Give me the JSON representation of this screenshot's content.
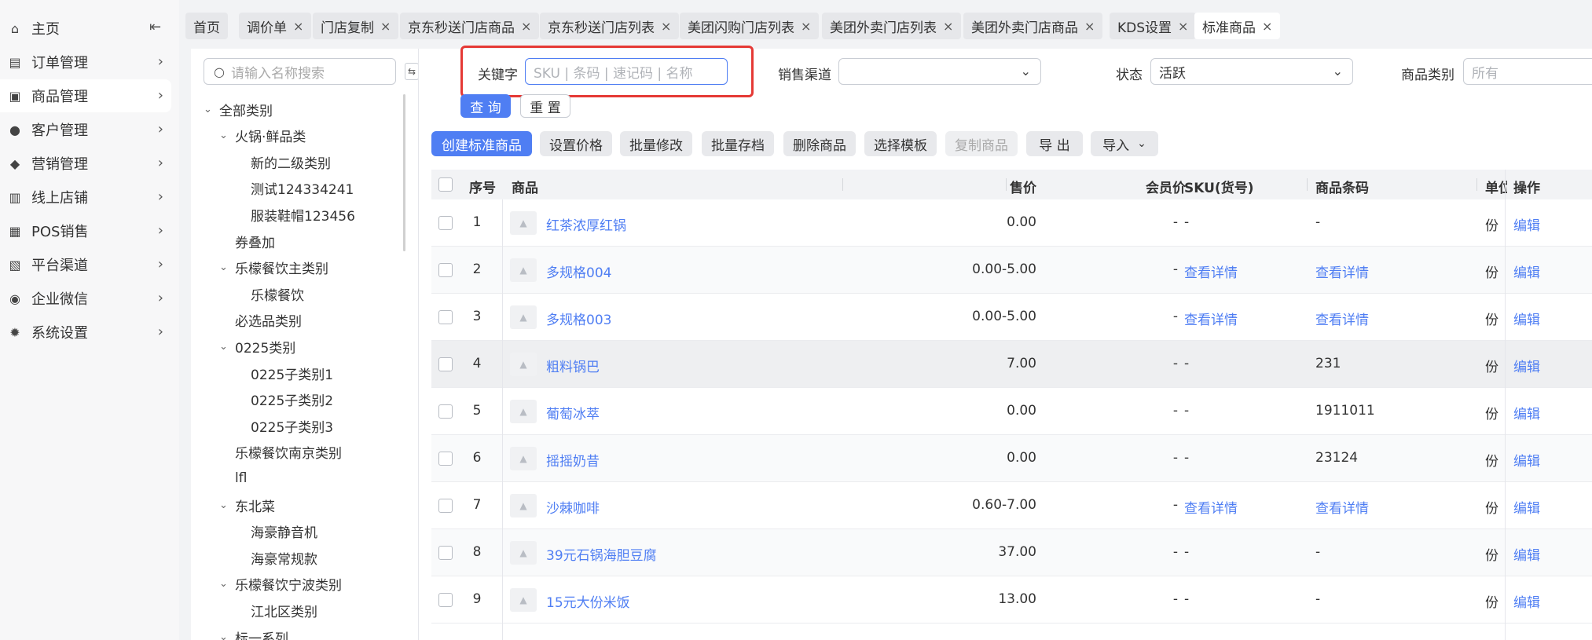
{
  "nav": {
    "items": [
      {
        "label": "主页",
        "icon": "home-icon",
        "glyph": "⌂",
        "has_chevron": false
      },
      {
        "label": "订单管理",
        "icon": "order-icon",
        "glyph": "▤",
        "has_chevron": true
      },
      {
        "label": "商品管理",
        "icon": "goods-icon",
        "glyph": "▣",
        "has_chevron": true
      },
      {
        "label": "客户管理",
        "icon": "customer-icon",
        "glyph": "●",
        "has_chevron": true
      },
      {
        "label": "营销管理",
        "icon": "tag-icon",
        "glyph": "◆",
        "has_chevron": true
      },
      {
        "label": "线上店铺",
        "icon": "store-icon",
        "glyph": "▥",
        "has_chevron": true
      },
      {
        "label": "POS销售",
        "icon": "pos-icon",
        "glyph": "▦",
        "has_chevron": true
      },
      {
        "label": "平台渠道",
        "icon": "bank-icon",
        "glyph": "▧",
        "has_chevron": true
      },
      {
        "label": "企业微信",
        "icon": "wechat-icon",
        "glyph": "◉",
        "has_chevron": true
      },
      {
        "label": "系统设置",
        "icon": "gear-icon",
        "glyph": "✹",
        "has_chevron": true
      }
    ],
    "active_index": 2,
    "collapse_glyph": "⇤",
    "chevron_glyph": "›"
  },
  "tabs": [
    {
      "label": "首页",
      "closable": false
    },
    {
      "label": "调价单",
      "closable": true
    },
    {
      "label": "门店复制",
      "closable": true
    },
    {
      "label": "京东秒送门店商品",
      "closable": true
    },
    {
      "label": "京东秒送门店列表",
      "closable": true
    },
    {
      "label": "美团闪购门店列表",
      "closable": true
    },
    {
      "label": "美团外卖门店列表",
      "closable": true
    },
    {
      "label": "美团外卖门店商品",
      "closable": true
    },
    {
      "label": "KDS设置",
      "closable": true
    },
    {
      "label": "标准商品",
      "closable": true
    }
  ],
  "active_tab": 9,
  "category": {
    "search_placeholder": "请输入名称搜索",
    "toggle_glyph": "⇆",
    "tree": [
      {
        "label": "全部类别",
        "level": 0,
        "expanded": true
      },
      {
        "label": "火锅·鲜品类",
        "level": 1,
        "expanded": true
      },
      {
        "label": "新的二级类别",
        "level": 2
      },
      {
        "label": "测试124334241",
        "level": 2
      },
      {
        "label": "服装鞋帽123456",
        "level": 2
      },
      {
        "label": "券叠加",
        "level": 1
      },
      {
        "label": "乐檬餐饮主类别",
        "level": 1,
        "expanded": true
      },
      {
        "label": "乐檬餐饮",
        "level": 2
      },
      {
        "label": "必选品类别",
        "level": 1
      },
      {
        "label": "0225类别",
        "level": 1,
        "expanded": true
      },
      {
        "label": "0225子类别1",
        "level": 2
      },
      {
        "label": "0225子类别2",
        "level": 2
      },
      {
        "label": "0225子类别3",
        "level": 2
      },
      {
        "label": "乐檬餐饮南京类别",
        "level": 1
      },
      {
        "label": "lfl",
        "level": 1
      },
      {
        "label": "东北菜",
        "level": 1,
        "expanded": true
      },
      {
        "label": "海豪静音机",
        "level": 2
      },
      {
        "label": "海豪常规款",
        "level": 2
      },
      {
        "label": "乐檬餐饮宁波类别",
        "level": 1,
        "expanded": true
      },
      {
        "label": "江北区类别",
        "level": 2
      },
      {
        "label": "标一系列",
        "level": 1,
        "expanded": true
      }
    ]
  },
  "filters": {
    "keyword_label": "关键字",
    "keyword_placeholder": "SKU | 条码 | 速记码 | 名称",
    "channel_label": "销售渠道",
    "channel_value": "",
    "status_label": "状态",
    "status_value": "活跃",
    "category_label": "商品类别",
    "category_placeholder": "所有",
    "query_button": "查 询",
    "reset_button": "重 置"
  },
  "toolbar": {
    "create": "创建标准商品",
    "set_price": "设置价格",
    "batch_edit": "批量修改",
    "batch_archive": "批量存档",
    "delete": "删除商品",
    "choose_template": "选择模板",
    "copy": "复制商品",
    "export": "导 出",
    "import": "导入"
  },
  "table": {
    "headers": {
      "index": "序号",
      "product": "商品",
      "price": "售价",
      "member_price": "会员价",
      "sku": "SKU(货号)",
      "barcode": "商品条码",
      "unit": "单位",
      "action": "操作"
    },
    "rows": [
      {
        "index": "1",
        "name": "红茶浓厚红锅",
        "price": "0.00",
        "member_price": "-",
        "sku": "-",
        "barcode": "-",
        "unit": "份",
        "action": "编辑",
        "sku_link": false,
        "barcode_link": false
      },
      {
        "index": "2",
        "name": "多规格004",
        "price": "0.00-5.00",
        "member_price": "-",
        "sku": "查看详情",
        "barcode": "查看详情",
        "unit": "份",
        "action": "编辑",
        "sku_link": true,
        "barcode_link": true
      },
      {
        "index": "3",
        "name": "多规格003",
        "price": "0.00-5.00",
        "member_price": "-",
        "sku": "查看详情",
        "barcode": "查看详情",
        "unit": "份",
        "action": "编辑",
        "sku_link": true,
        "barcode_link": true
      },
      {
        "index": "4",
        "name": "粗料锅巴",
        "price": "7.00",
        "member_price": "-",
        "sku": "-",
        "barcode": "231",
        "unit": "份",
        "action": "编辑",
        "sku_link": false,
        "barcode_link": false
      },
      {
        "index": "5",
        "name": "葡萄冰萃",
        "price": "0.00",
        "member_price": "-",
        "sku": "-",
        "barcode": "1911011",
        "unit": "份",
        "action": "编辑",
        "sku_link": false,
        "barcode_link": false
      },
      {
        "index": "6",
        "name": "摇摇奶昔",
        "price": "0.00",
        "member_price": "-",
        "sku": "-",
        "barcode": "23124",
        "unit": "份",
        "action": "编辑",
        "sku_link": false,
        "barcode_link": false
      },
      {
        "index": "7",
        "name": "沙棘咖啡",
        "price": "0.60-7.00",
        "member_price": "-",
        "sku": "查看详情",
        "barcode": "查看详情",
        "unit": "份",
        "action": "编辑",
        "sku_link": true,
        "barcode_link": true
      },
      {
        "index": "8",
        "name": "39元石锅海胆豆腐",
        "price": "37.00",
        "member_price": "-",
        "sku": "-",
        "barcode": "-",
        "unit": "份",
        "action": "编辑",
        "sku_link": false,
        "barcode_link": false
      },
      {
        "index": "9",
        "name": "15元大份米饭",
        "price": "13.00",
        "member_price": "-",
        "sku": "-",
        "barcode": "-",
        "unit": "份",
        "action": "编辑",
        "sku_link": false,
        "barcode_link": false
      }
    ]
  },
  "colors": {
    "accent": "#4f7ef3",
    "highlight": "#e53935"
  }
}
